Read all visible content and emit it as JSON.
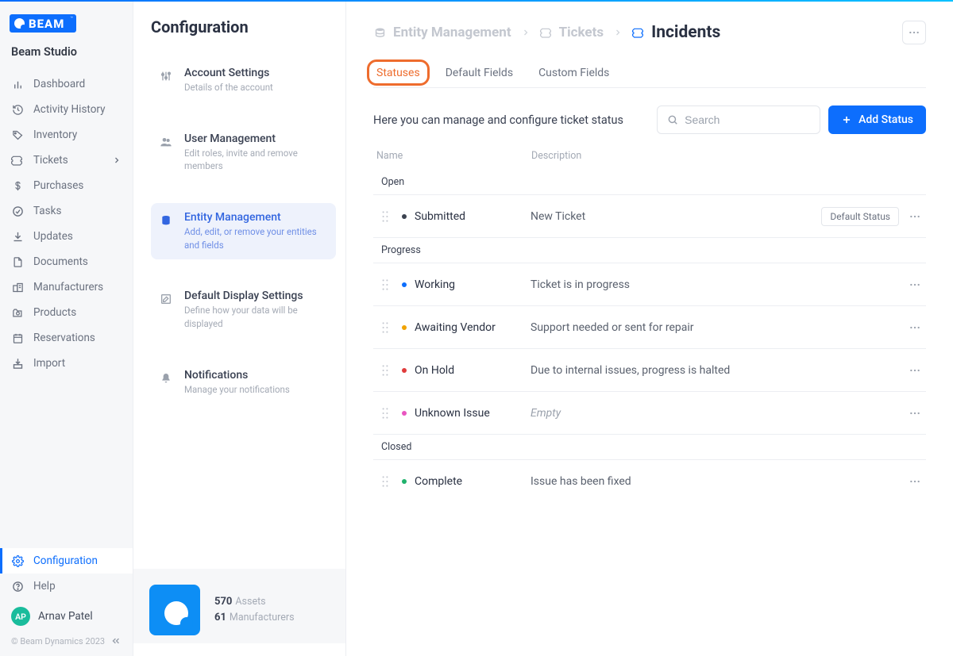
{
  "tenant": "Beam Studio",
  "logo_text": "BEAM",
  "sidebar": {
    "items": [
      {
        "label": "Dashboard",
        "icon": "bar-chart-icon"
      },
      {
        "label": "Activity History",
        "icon": "clock-history-icon"
      },
      {
        "label": "Inventory",
        "icon": "tag-icon"
      },
      {
        "label": "Tickets",
        "icon": "ticket-icon",
        "has_sub": true
      },
      {
        "label": "Purchases",
        "icon": "dollar-icon"
      },
      {
        "label": "Tasks",
        "icon": "check-circle-icon"
      },
      {
        "label": "Updates",
        "icon": "download-icon"
      },
      {
        "label": "Documents",
        "icon": "file-icon"
      },
      {
        "label": "Manufacturers",
        "icon": "building-icon"
      },
      {
        "label": "Products",
        "icon": "camera-icon"
      },
      {
        "label": "Reservations",
        "icon": "calendar-icon"
      },
      {
        "label": "Import",
        "icon": "import-icon"
      }
    ],
    "bottom": [
      {
        "label": "Configuration",
        "icon": "gear-icon",
        "active": true
      },
      {
        "label": "Help",
        "icon": "help-icon"
      }
    ]
  },
  "user": {
    "initials": "AP",
    "name": "Arnav Patel"
  },
  "copyright": "© Beam Dynamics 2023",
  "config": {
    "title": "Configuration",
    "items": [
      {
        "title": "Account Settings",
        "desc": "Details of the account",
        "icon": "sliders-icon"
      },
      {
        "title": "User Management",
        "desc": "Edit roles, invite and remove members",
        "icon": "users-icon"
      },
      {
        "title": "Entity Management",
        "desc": "Add, edit, or remove your entities and fields",
        "icon": "database-icon",
        "active": true
      },
      {
        "title": "Default Display Settings",
        "desc": "Define how your data will be displayed",
        "icon": "edit-square-icon"
      },
      {
        "title": "Notifications",
        "desc": "Manage your notifications",
        "icon": "bell-icon"
      }
    ],
    "footer": {
      "assets_count": "570",
      "assets_label": "Assets",
      "mfrs_count": "61",
      "mfrs_label": "Manufacturers"
    }
  },
  "breadcrumbs": [
    {
      "label": "Entity Management",
      "icon": "stack-icon"
    },
    {
      "label": "Tickets",
      "icon": "ticket-icon"
    },
    {
      "label": "Incidents",
      "icon": "ticket-icon"
    }
  ],
  "tabs": [
    {
      "label": "Statuses",
      "highlight": true
    },
    {
      "label": "Default Fields"
    },
    {
      "label": "Custom Fields"
    }
  ],
  "help_text": "Here you can manage and configure ticket status",
  "search_placeholder": "Search",
  "add_button_label": "Add Status",
  "columns": {
    "name": "Name",
    "desc": "Description"
  },
  "default_badge": "Default Status",
  "empty_text": "Empty",
  "groups": [
    {
      "label": "Open",
      "rows": [
        {
          "name": "Submitted",
          "desc": "New Ticket",
          "color": "#3b4250",
          "default": true
        }
      ]
    },
    {
      "label": "Progress",
      "rows": [
        {
          "name": "Working",
          "desc": "Ticket is in progress",
          "color": "#0d6efd"
        },
        {
          "name": "Awaiting Vendor",
          "desc": "Support needed or sent for repair",
          "color": "#f1a300"
        },
        {
          "name": "On Hold",
          "desc": "Due to internal issues, progress is halted",
          "color": "#e03b3b"
        },
        {
          "name": "Unknown Issue",
          "desc": "",
          "color": "#e955c0"
        }
      ]
    },
    {
      "label": "Closed",
      "rows": [
        {
          "name": "Complete",
          "desc": "Issue has been fixed",
          "color": "#20b26c"
        }
      ]
    }
  ]
}
